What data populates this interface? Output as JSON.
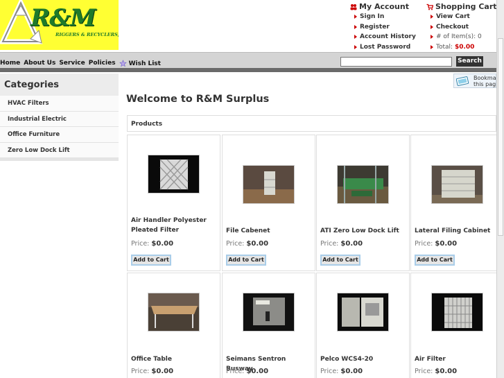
{
  "logo": {
    "brand": "R&M",
    "tagline": "RIGGERS & RECYCLERS, INC."
  },
  "account": {
    "title": "My Account",
    "items": [
      "Sign In",
      "Register",
      "Account History",
      "Lost Password"
    ]
  },
  "cart": {
    "title": "Shopping Cart",
    "items": [
      "View Cart",
      "Checkout"
    ],
    "items_label": "# of Item(s): 0",
    "total_label": "Total:",
    "total_value": "$0.00"
  },
  "nav": {
    "links": [
      "Home",
      "About Us",
      "Service",
      "Policies"
    ],
    "wishlist": "Wish List",
    "search_value": "",
    "search_button": "Search"
  },
  "sidebar": {
    "title": "Categories",
    "items": [
      "HVAC Filters",
      "Industrial Electric",
      "Office Furniture",
      "Zero Low Dock Lift"
    ]
  },
  "bookmark": {
    "text": "Bookmark\nthis page"
  },
  "main": {
    "welcome": "Welcome to R&M Surplus",
    "products_heading": "Products",
    "price_label": "Price:",
    "add_label": "Add to Cart",
    "products": [
      {
        "name": "Air Handler Polyester Pleated Filter",
        "price": "$0.00"
      },
      {
        "name": "File Cabenet",
        "price": "$0.00"
      },
      {
        "name": "ATI Zero Low Dock Lift",
        "price": "$0.00"
      },
      {
        "name": "Lateral Filing Cabinet",
        "price": "$0.00"
      },
      {
        "name": "Office Table",
        "price": "$0.00"
      },
      {
        "name": "Seimans Sentron Busway",
        "price": "$0.00"
      },
      {
        "name": "Pelco WCS4-20",
        "price": "$0.00"
      },
      {
        "name": "Air Filter",
        "price": "$0.00"
      }
    ]
  },
  "colors": {
    "logo_bg": "#ffff33",
    "brand_green": "#1f7a2a",
    "accent_red": "#cc0000",
    "nav_bg": "#d4d4d4"
  }
}
